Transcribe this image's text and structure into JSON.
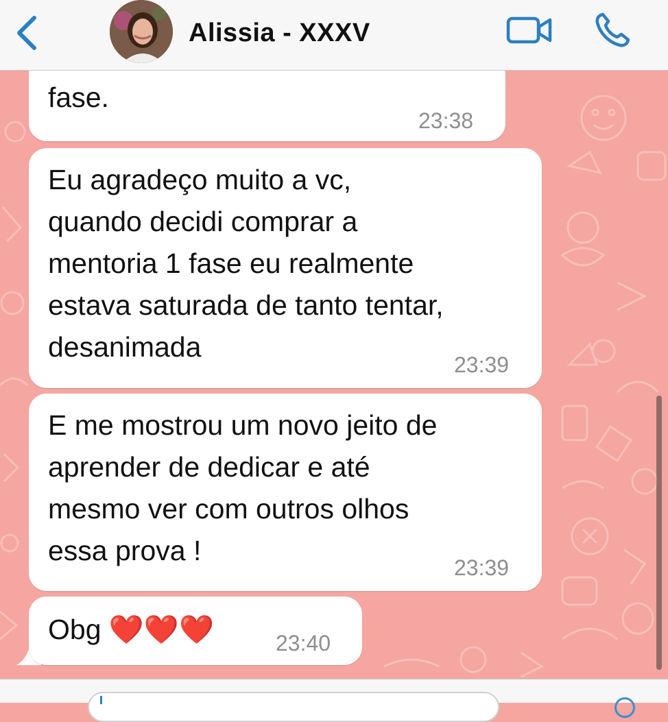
{
  "header": {
    "back_icon": "chevron-left-icon",
    "contact_name": "Alissia - XXXV",
    "video_icon": "video-camera-icon",
    "phone_icon": "phone-icon",
    "accent_color": "#2d7fc0"
  },
  "messages": [
    {
      "text": "fase.",
      "time": "23:38"
    },
    {
      "text": "Eu agradeço muito a vc,\nquando decidi comprar a\nmentoria 1 fase eu realmente\nestava saturada de tanto tentar,\ndesanimada",
      "time": "23:39"
    },
    {
      "text": "E me mostrou um novo jeito de\naprender de dedicar e até\nmesmo ver com outros olhos\nessa prova !",
      "time": "23:39"
    },
    {
      "text": "Obg ❤️❤️❤️",
      "time": "23:40"
    }
  ],
  "colors": {
    "chat_background": "#f5a6a0",
    "bubble": "#ffffff",
    "timestamp": "#8e8e8e"
  }
}
